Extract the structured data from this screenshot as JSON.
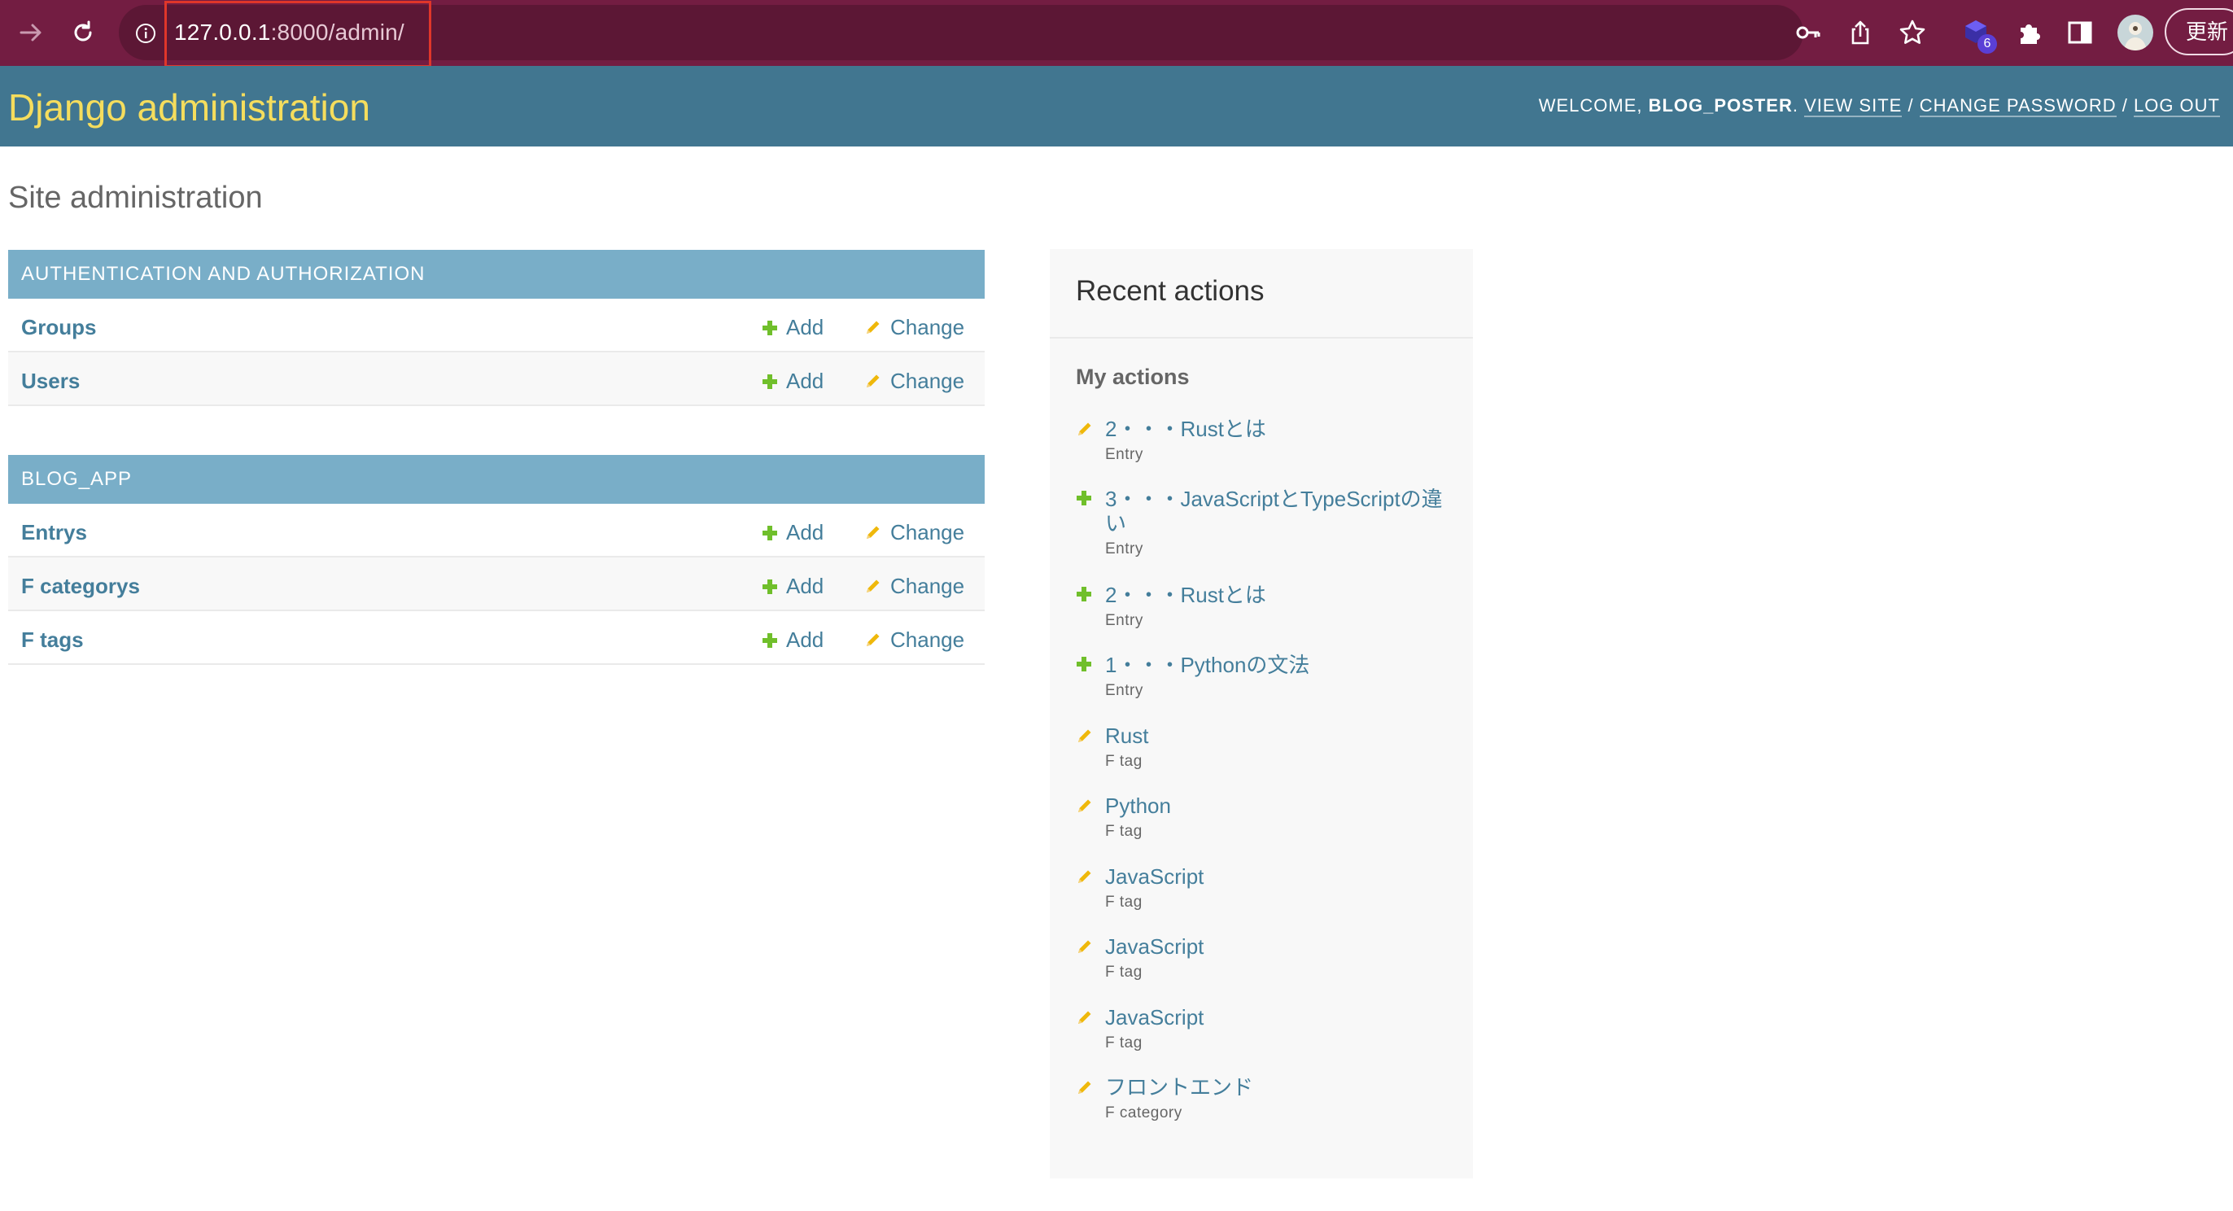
{
  "browser": {
    "url_host": "127.0.0.1",
    "url_rest": ":8000/admin/",
    "extension_badge": "6",
    "update_label": "更新"
  },
  "header": {
    "branding": "Django administration",
    "welcome": "WELCOME, ",
    "username": "BLOG_POSTER",
    "view_site": "VIEW SITE",
    "change_password": "CHANGE PASSWORD",
    "log_out": "LOG OUT",
    "separator": " / "
  },
  "page_title": "Site administration",
  "modules": [
    {
      "caption": "AUTHENTICATION AND AUTHORIZATION",
      "models": [
        {
          "name": "Groups",
          "add": "Add",
          "change": "Change"
        },
        {
          "name": "Users",
          "add": "Add",
          "change": "Change"
        }
      ]
    },
    {
      "caption": "BLOG_APP",
      "models": [
        {
          "name": "Entrys",
          "add": "Add",
          "change": "Change"
        },
        {
          "name": "F categorys",
          "add": "Add",
          "change": "Change"
        },
        {
          "name": "F tags",
          "add": "Add",
          "change": "Change"
        }
      ]
    }
  ],
  "recent": {
    "title": "Recent actions",
    "subtitle": "My actions",
    "actions": [
      {
        "icon": "pencil-icon",
        "text": "2・・・Rustとは",
        "type": "Entry"
      },
      {
        "icon": "plus-icon",
        "text": "3・・・JavaScriptとTypeScriptの違い",
        "type": "Entry"
      },
      {
        "icon": "plus-icon",
        "text": "2・・・Rustとは",
        "type": "Entry"
      },
      {
        "icon": "plus-icon",
        "text": "1・・・Pythonの文法",
        "type": "Entry"
      },
      {
        "icon": "pencil-icon",
        "text": "Rust",
        "type": "F tag"
      },
      {
        "icon": "pencil-icon",
        "text": "Python",
        "type": "F tag"
      },
      {
        "icon": "pencil-icon",
        "text": "JavaScript",
        "type": "F tag"
      },
      {
        "icon": "pencil-icon",
        "text": "JavaScript",
        "type": "F tag"
      },
      {
        "icon": "pencil-icon",
        "text": "JavaScript",
        "type": "F tag"
      },
      {
        "icon": "pencil-icon",
        "text": "フロントエンド",
        "type": "F category"
      }
    ]
  },
  "colors": {
    "chrome": "#731d42",
    "header": "#417690",
    "branding": "#f5dd5d",
    "caption": "#79aec8",
    "link": "#447e9b",
    "add_green": "#70bf2b",
    "change_yellow": "#efb80b"
  }
}
